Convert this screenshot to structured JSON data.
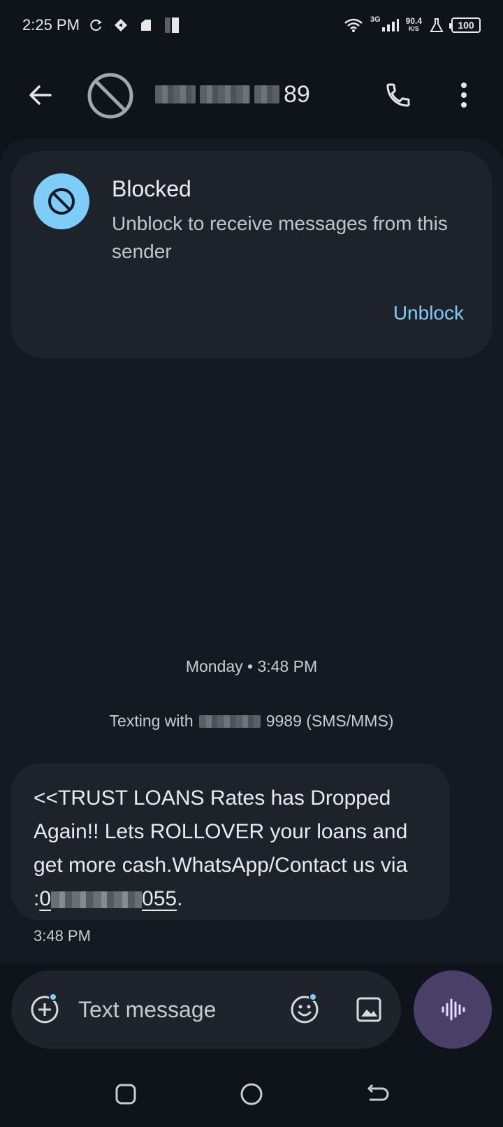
{
  "status_bar": {
    "time": "2:25 PM",
    "network_type": "3G",
    "net_speed_value": "90.4",
    "net_speed_unit": "K/S",
    "battery": "100"
  },
  "app_bar": {
    "contact_suffix": "89",
    "back_label": "Back",
    "call_label": "Call",
    "more_label": "More options"
  },
  "blocked_card": {
    "title": "Blocked",
    "description": "Unblock to receive messages from this sender",
    "action_label": "Unblock"
  },
  "conversation": {
    "timestamp": "Monday • 3:48 PM",
    "texting_with_prefix": "Texting with",
    "texting_with_suffix": "9989 (SMS/MMS)",
    "message": {
      "text_line": "<<TRUST LOANS  Rates has Dropped Again!! Lets ROLLOVER your loans and get more cash.WhatsApp/Contact us via :",
      "link_prefix": "0",
      "link_suffix": "055",
      "trailing": ".",
      "time": "3:48 PM"
    }
  },
  "composer": {
    "placeholder": "Text message"
  },
  "colors": {
    "background": "#0f141b",
    "surface": "#1e232b",
    "accent": "#7dcdf7",
    "voice_button": "#4a3f67"
  },
  "icons": [
    "back-arrow-icon",
    "blocked-icon",
    "phone-icon",
    "more-vert-icon",
    "add-circle-icon",
    "emoji-icon",
    "image-icon",
    "voice-waveform-icon",
    "recents-icon",
    "home-icon",
    "back-nav-icon"
  ]
}
